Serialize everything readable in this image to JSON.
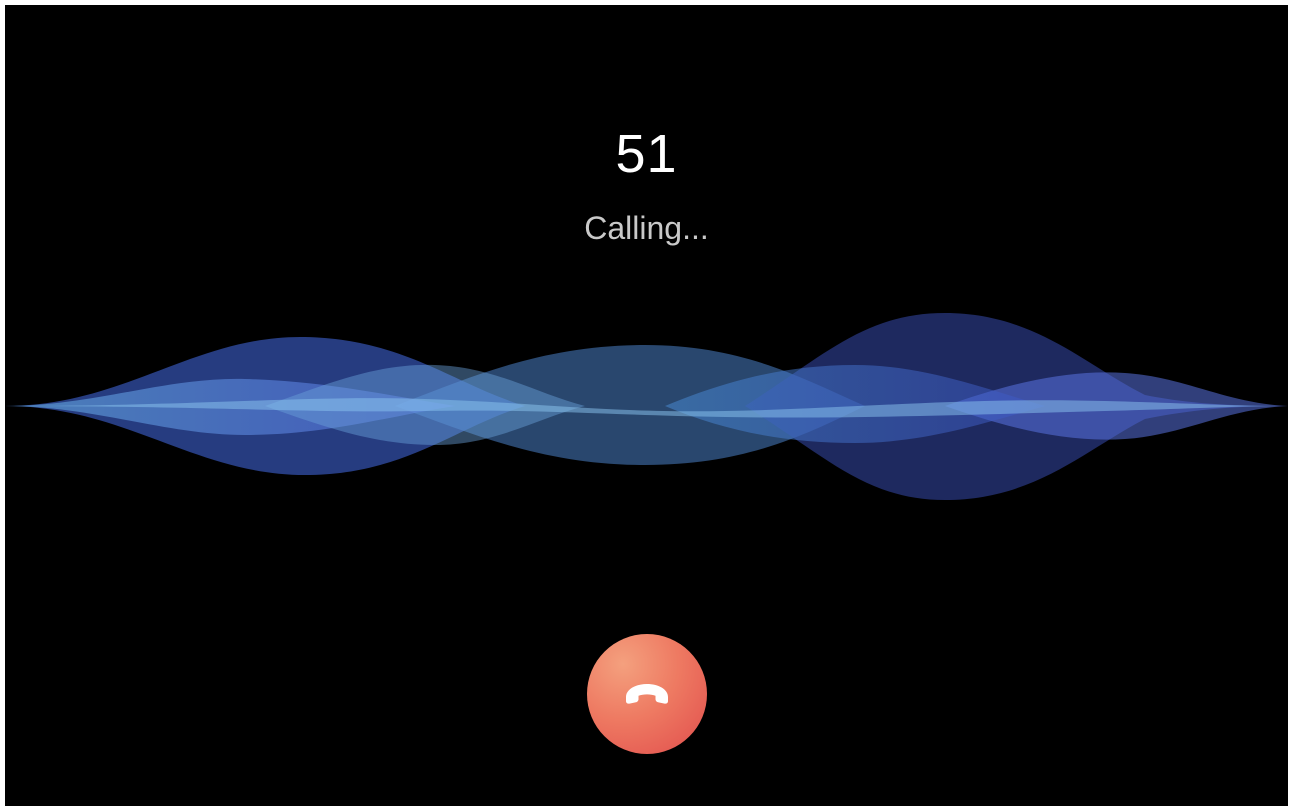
{
  "call": {
    "caller": "51",
    "status": "Calling..."
  },
  "controls": {
    "end_call_icon": "phone-hangup-icon"
  },
  "colors": {
    "background": "#000000",
    "wave_light": "#6fb4e6",
    "wave_dark": "#3f5bc8",
    "end_call_accent": "#e85a52"
  }
}
